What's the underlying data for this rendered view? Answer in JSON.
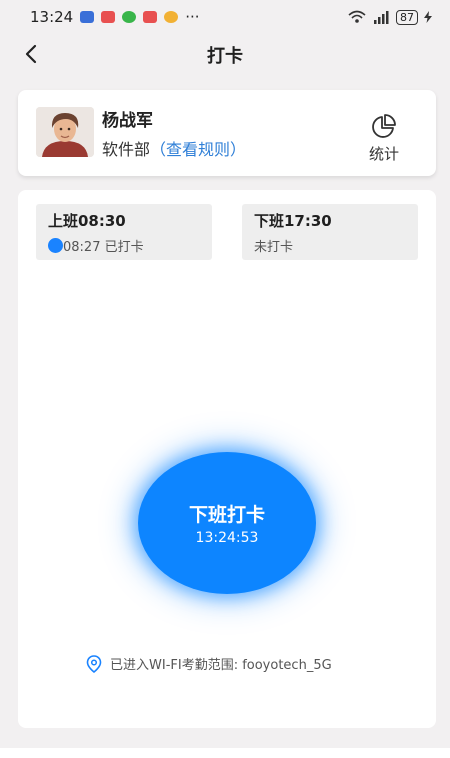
{
  "status_bar": {
    "time": "13:24",
    "more": "···",
    "battery": "87"
  },
  "header": {
    "title": "打卡"
  },
  "profile": {
    "name": "杨战军",
    "department": "软件部",
    "rules_link": "（查看规则）",
    "stats_label": "统计"
  },
  "shifts": [
    {
      "title": "上班08:30",
      "status": "08:27 已打卡"
    },
    {
      "title": "下班17:30",
      "status": "未打卡"
    }
  ],
  "clock_button": {
    "label": "下班打卡",
    "time": "13:24:53"
  },
  "wifi": {
    "text": "已进入WI-FI考勤范围:  fooyotech_5G"
  },
  "colors": {
    "accent": "#0d85ff",
    "link": "#2f7fd7",
    "background": "#f2f0f1"
  }
}
